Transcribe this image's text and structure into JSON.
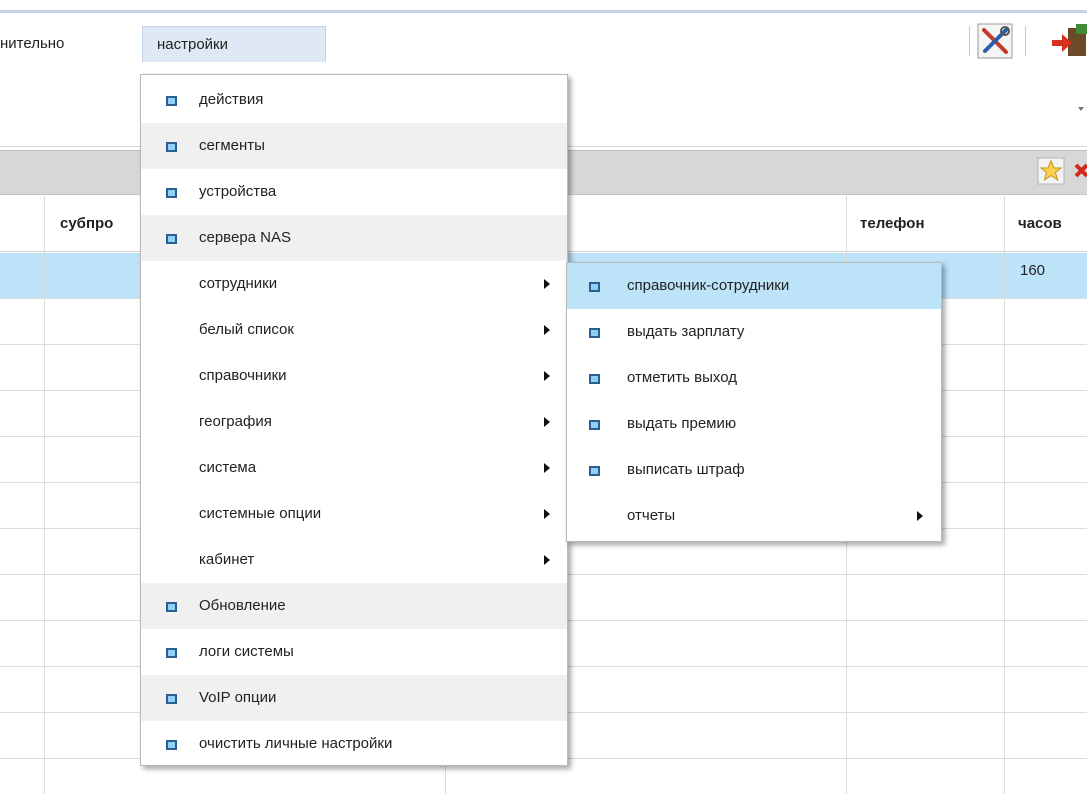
{
  "menubar": {
    "items": [
      {
        "label": "нительно"
      },
      {
        "label": "настройки"
      }
    ]
  },
  "icons": {
    "tools": "tools-icon",
    "exit": "exit-icon",
    "star": "star-icon",
    "delete": "delete-icon"
  },
  "grid": {
    "columns": [
      "субпро",
      "",
      "телефон",
      "часов"
    ],
    "selected_row_hours": "160"
  },
  "settings_menu": {
    "items": [
      {
        "label": "действия",
        "bullet": true
      },
      {
        "label": "сегменты",
        "bullet": true
      },
      {
        "label": "устройства",
        "bullet": true
      },
      {
        "label": "сервера NAS",
        "bullet": true
      },
      {
        "label": "сотрудники",
        "submenu": true
      },
      {
        "label": "белый список",
        "submenu": true
      },
      {
        "label": "справочники",
        "submenu": true
      },
      {
        "label": "география",
        "submenu": true
      },
      {
        "label": "система",
        "submenu": true
      },
      {
        "label": "системные опции",
        "submenu": true
      },
      {
        "label": "кабинет",
        "submenu": true
      },
      {
        "label": "Обновление",
        "bullet": true
      },
      {
        "label": "логи системы",
        "bullet": true
      },
      {
        "label": "VoIP опции",
        "bullet": true
      },
      {
        "label": "очистить личные настройки",
        "bullet": true
      }
    ]
  },
  "employees_submenu": {
    "items": [
      {
        "label": "справочник-сотрудники",
        "bullet": true
      },
      {
        "label": "выдать зарплату",
        "bullet": true
      },
      {
        "label": "отметить выход",
        "bullet": true
      },
      {
        "label": "выдать премию",
        "bullet": true
      },
      {
        "label": "выписать штраф",
        "bullet": true
      },
      {
        "label": "отчеты",
        "submenu": true
      }
    ]
  },
  "colors": {
    "highlight": "#bde3f9",
    "bullet_fill": "#8fd0f5",
    "bullet_border": "#2a5f8f",
    "menubar_active": "#dfe9f5",
    "caption_bar": "#d7d7d7"
  }
}
